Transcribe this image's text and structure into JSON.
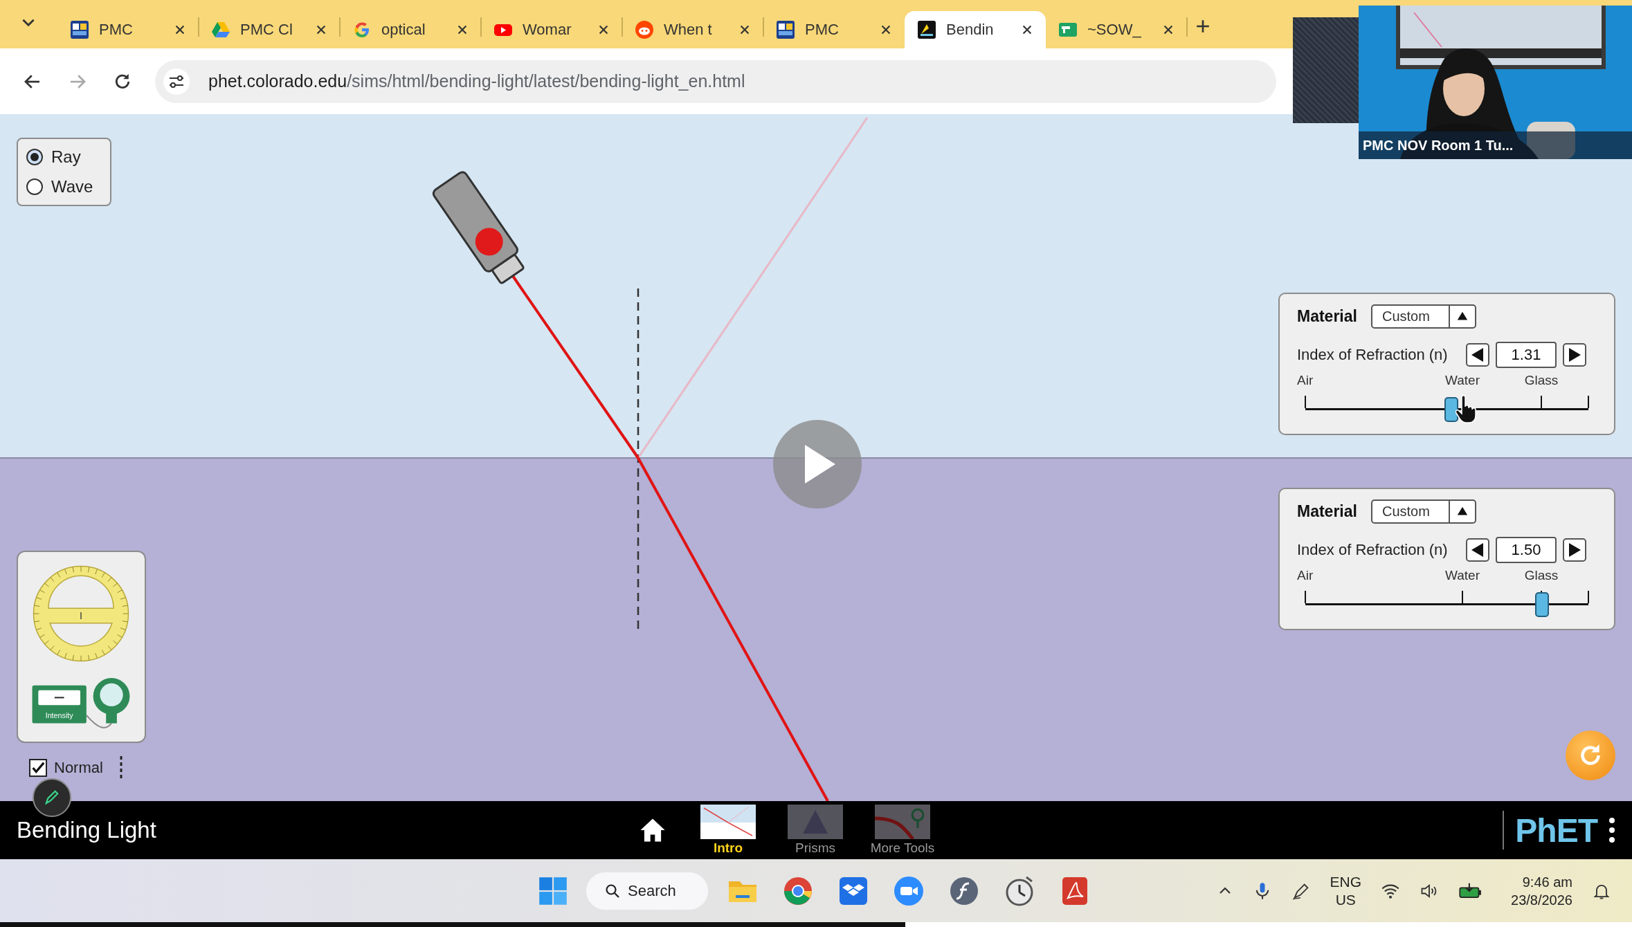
{
  "browser": {
    "tabs": [
      {
        "label": "PMC",
        "kind": "pmc",
        "selected": false
      },
      {
        "label": "PMC Cl",
        "kind": "drive",
        "selected": false
      },
      {
        "label": "optical",
        "kind": "google",
        "selected": false
      },
      {
        "label": "Womar",
        "kind": "youtube",
        "selected": false
      },
      {
        "label": "When t",
        "kind": "reddit",
        "selected": false
      },
      {
        "label": "PMC",
        "kind": "pmc",
        "selected": false
      },
      {
        "label": "Bendin",
        "kind": "phet",
        "selected": true
      },
      {
        "label": "~SOW_",
        "kind": "sheet",
        "selected": false
      }
    ],
    "url": {
      "host": "phet.colorado.edu",
      "path": "/sims/html/bending-light/latest/bending-light_en.html"
    }
  },
  "video": {
    "caption": "PMC NOV Room 1 Tu..."
  },
  "sim": {
    "modes": [
      {
        "label": "Ray",
        "selected": true
      },
      {
        "label": "Wave",
        "selected": false
      }
    ],
    "materials": [
      {
        "title": "Material",
        "choice": "Custom",
        "index_label": "Index of Refraction (n)",
        "value": "1.31",
        "scale": [
          "Air",
          "Water",
          "Glass"
        ],
        "level": 0.515
      },
      {
        "title": "Material",
        "choice": "Custom",
        "index_label": "Index of Refraction (n)",
        "value": "1.50",
        "scale": [
          "Air",
          "Water",
          "Glass"
        ],
        "level": 0.835
      }
    ],
    "toolbox": {
      "meter_label": "Intensity"
    },
    "normal": {
      "label": "Normal",
      "checked": true
    }
  },
  "navbar": {
    "title": "Bending Light",
    "screens": [
      {
        "label": "Intro",
        "kind": "intro",
        "selected": true
      },
      {
        "label": "Prisms",
        "kind": "prisms",
        "selected": false
      },
      {
        "label": "More Tools",
        "kind": "tools",
        "selected": false
      }
    ],
    "logo": "PhET"
  },
  "taskbar": {
    "search": "Search",
    "language": "ENG",
    "region": "US",
    "time": "9:46 am",
    "date": "23/8/2026"
  }
}
